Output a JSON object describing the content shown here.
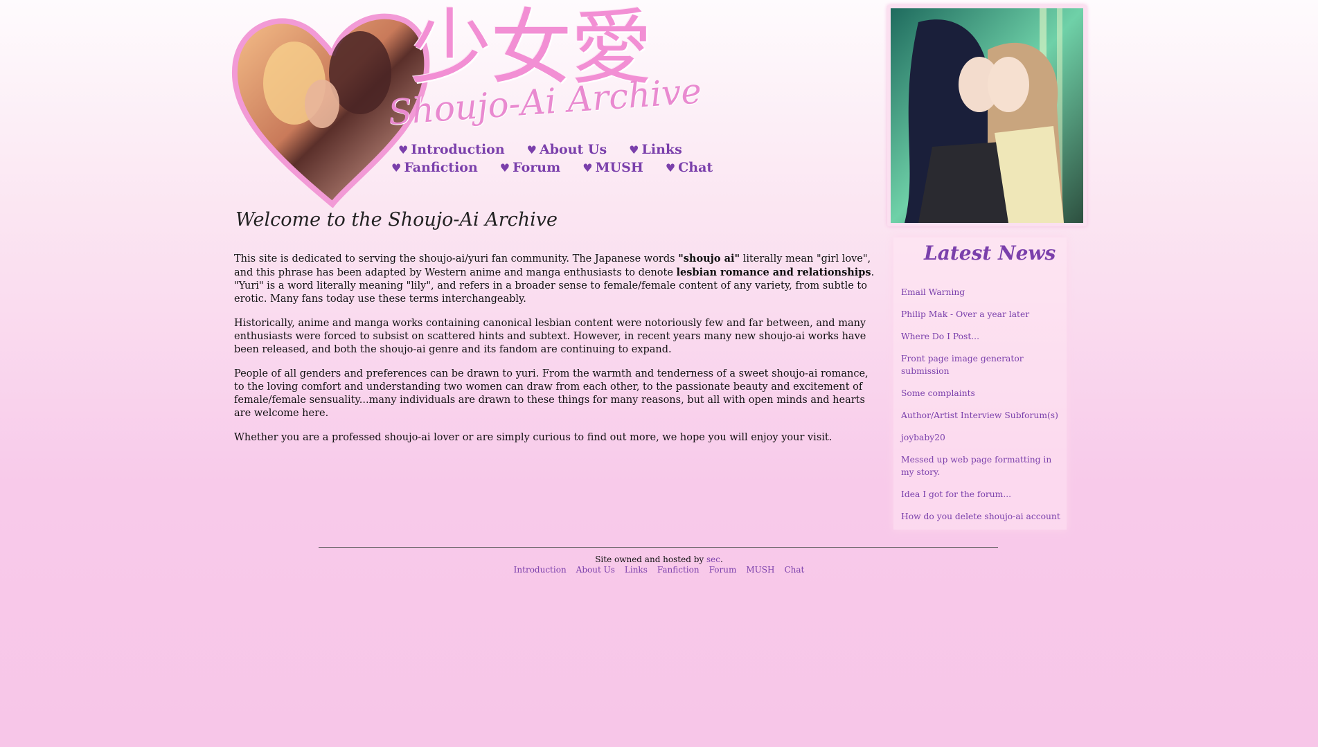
{
  "header": {
    "kanji": "少女愛",
    "site_title": "Shoujo-Ai Archive"
  },
  "nav": {
    "row1": [
      "Introduction",
      "About Us",
      "Links"
    ],
    "row2": [
      "Fanfiction",
      "Forum",
      "MUSH",
      "Chat"
    ],
    "icon": "heart-icon"
  },
  "main": {
    "welcome": "Welcome to the Shoujo-Ai Archive",
    "p1_a": "This site is dedicated to serving the shoujo-ai/yuri fan community. The Japanese words ",
    "p1_b": "\"shoujo ai\"",
    "p1_c": " literally mean \"girl love\", and this phrase has been adapted by Western anime and manga enthusiasts to denote ",
    "p1_d": "lesbian romance and relationships",
    "p1_e": ". \"Yuri\" is a word literally meaning \"lily\", and refers in a broader sense to female/female content of any variety, from subtle to erotic. Many fans today use these terms interchangeably.",
    "p2": "Historically, anime and manga works containing canonical lesbian content were notoriously few and far between, and many enthusiasts were forced to subsist on scattered hints and subtext. However, in recent years many new shoujo-ai works have been released, and both the shoujo-ai genre and its fandom are continuing to expand.",
    "p3": "People of all genders and preferences can be drawn to yuri. From the warmth and tenderness of a sweet shoujo-ai romance, to the loving comfort and understanding two women can draw from each other, to the passionate beauty and excitement of female/female sensuality...many individuals are drawn to these things for many reasons, but all with open minds and hearts are welcome here.",
    "p4": "Whether you are a professed shoujo-ai lover or are simply curious to find out more, we hope you will enjoy your visit."
  },
  "news": {
    "title": "Latest News",
    "items": [
      "Email Warning",
      "Philip Mak - Over a year later",
      "Where Do I Post...",
      "Front page image generator submission",
      "Some complaints",
      "Author/Artist Interview Subforum(s)",
      "joybaby20",
      "Messed up web page formatting in my story.",
      "Idea I got for the forum...",
      "How do you delete shoujo-ai account"
    ]
  },
  "footer": {
    "owner_prefix": "Site owned and hosted by ",
    "owner_name": "sec",
    "owner_suffix": ".",
    "links": [
      "Introduction",
      "About Us",
      "Links",
      "Fanfiction",
      "Forum",
      "MUSH",
      "Chat"
    ]
  },
  "colors": {
    "link": "#7a3fab",
    "logo_pink": "#f28fd4",
    "background_pink": "#f7c6e8"
  }
}
